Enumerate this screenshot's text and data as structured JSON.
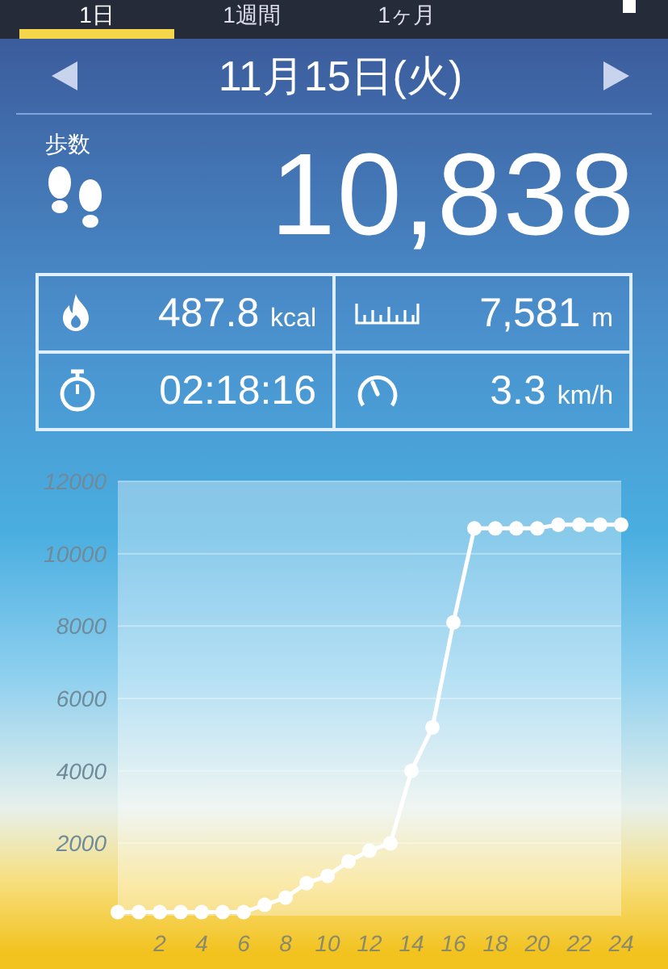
{
  "tabs": [
    {
      "label": "1日",
      "selected": true
    },
    {
      "label": "1週間",
      "selected": false
    },
    {
      "label": "1ヶ月",
      "selected": false
    }
  ],
  "date": {
    "label": "11月15日(火)"
  },
  "steps": {
    "label": "歩数",
    "value": "10,838"
  },
  "stats": [
    {
      "kind": "calories",
      "value": "487.8",
      "unit": "kcal"
    },
    {
      "kind": "distance",
      "value": "7,581",
      "unit": "m"
    },
    {
      "kind": "time",
      "value": "02:18:16"
    },
    {
      "kind": "speed",
      "value": "3.3",
      "unit": "km/h"
    }
  ],
  "chart_data": {
    "type": "line",
    "x": [
      0,
      1,
      2,
      3,
      4,
      5,
      6,
      7,
      8,
      9,
      10,
      11,
      12,
      13,
      14,
      15,
      16,
      17,
      18,
      19,
      20,
      21,
      22,
      23,
      24
    ],
    "series": [
      {
        "color": "#ffffff",
        "marker": true,
        "values": [
          100,
          100,
          100,
          100,
          100,
          100,
          100,
          300,
          500,
          900,
          1100,
          1500,
          1800,
          2000,
          4000,
          5200,
          8100,
          10700,
          10700,
          10700,
          10700,
          10800,
          10800,
          10800,
          10800
        ]
      }
    ],
    "grid": true,
    "xlim": [
      0,
      24
    ],
    "ylim": [
      0,
      12000
    ],
    "xticks": [
      2,
      4,
      6,
      8,
      10,
      12,
      14,
      16,
      18,
      20,
      22,
      24
    ],
    "yticks": [
      2000,
      4000,
      6000,
      8000,
      10000,
      12000
    ]
  }
}
